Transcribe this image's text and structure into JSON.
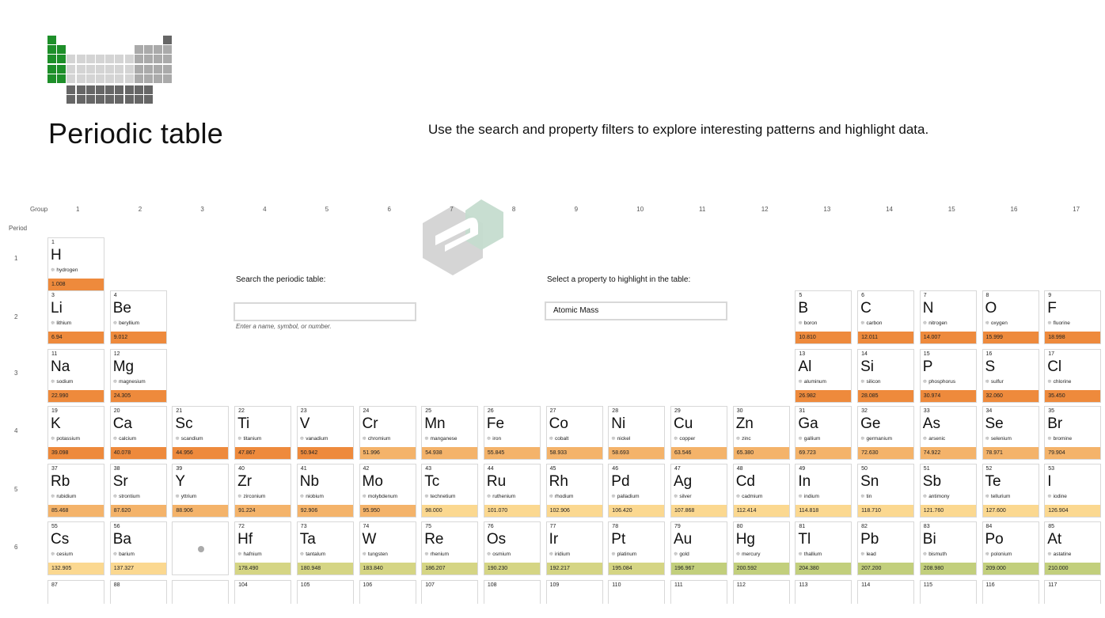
{
  "header": {
    "title": "Periodic table",
    "subtitle": "Use the search and property filters to explore interesting patterns and highlight data."
  },
  "axis": {
    "group_label": "Group",
    "period_label": "Period",
    "groups": [
      "1",
      "2",
      "3",
      "4",
      "5",
      "6",
      "7",
      "8",
      "9",
      "10",
      "11",
      "12",
      "13",
      "14",
      "15",
      "16",
      "17"
    ],
    "periods": [
      "1",
      "2",
      "3",
      "4",
      "5",
      "6"
    ]
  },
  "search": {
    "label": "Search the periodic table:",
    "value": "",
    "placeholder": "",
    "hint": "Enter a name, symbol, or number."
  },
  "property": {
    "label": "Select a property to highlight in the table:",
    "selected": "Atomic Mass"
  },
  "colors": {
    "mass_low": "#ee8a3c",
    "mass_mid": "#f4b36a",
    "mass_light": "#fbd890",
    "mass_olive": "#d5d584",
    "mass_green": "#c2cf7c",
    "logo_green": "#1e8f2a",
    "logo_light": "#d4d4d4",
    "logo_mid": "#aaaaaa",
    "logo_dark": "#666666"
  },
  "elements": [
    {
      "n": "1",
      "s": "H",
      "name": "hydrogen",
      "mass": "1.008",
      "g": 1,
      "p": 1,
      "c": "mass_low"
    },
    {
      "n": "3",
      "s": "Li",
      "name": "lithium",
      "mass": "6.94",
      "g": 1,
      "p": 2,
      "c": "mass_low"
    },
    {
      "n": "4",
      "s": "Be",
      "name": "beryllium",
      "mass": "9.012",
      "g": 2,
      "p": 2,
      "c": "mass_low"
    },
    {
      "n": "5",
      "s": "B",
      "name": "boron",
      "mass": "10.810",
      "g": 13,
      "p": 2,
      "c": "mass_low"
    },
    {
      "n": "6",
      "s": "C",
      "name": "carbon",
      "mass": "12.011",
      "g": 14,
      "p": 2,
      "c": "mass_low"
    },
    {
      "n": "7",
      "s": "N",
      "name": "nitrogen",
      "mass": "14.007",
      "g": 15,
      "p": 2,
      "c": "mass_low"
    },
    {
      "n": "8",
      "s": "O",
      "name": "oxygen",
      "mass": "15.999",
      "g": 16,
      "p": 2,
      "c": "mass_low"
    },
    {
      "n": "9",
      "s": "F",
      "name": "fluorine",
      "mass": "18.998",
      "g": 17,
      "p": 2,
      "c": "mass_low"
    },
    {
      "n": "11",
      "s": "Na",
      "name": "sodium",
      "mass": "22.990",
      "g": 1,
      "p": 3,
      "c": "mass_low"
    },
    {
      "n": "12",
      "s": "Mg",
      "name": "magnesium",
      "mass": "24.305",
      "g": 2,
      "p": 3,
      "c": "mass_low"
    },
    {
      "n": "13",
      "s": "Al",
      "name": "aluminum",
      "mass": "26.982",
      "g": 13,
      "p": 3,
      "c": "mass_low"
    },
    {
      "n": "14",
      "s": "Si",
      "name": "silicon",
      "mass": "28.085",
      "g": 14,
      "p": 3,
      "c": "mass_low"
    },
    {
      "n": "15",
      "s": "P",
      "name": "phosphorus",
      "mass": "30.974",
      "g": 15,
      "p": 3,
      "c": "mass_low"
    },
    {
      "n": "16",
      "s": "S",
      "name": "sulfur",
      "mass": "32.060",
      "g": 16,
      "p": 3,
      "c": "mass_low"
    },
    {
      "n": "17",
      "s": "Cl",
      "name": "chlorine",
      "mass": "35.450",
      "g": 17,
      "p": 3,
      "c": "mass_low"
    },
    {
      "n": "19",
      "s": "K",
      "name": "potassium",
      "mass": "39.098",
      "g": 1,
      "p": 4,
      "c": "mass_low"
    },
    {
      "n": "20",
      "s": "Ca",
      "name": "calcium",
      "mass": "40.078",
      "g": 2,
      "p": 4,
      "c": "mass_low"
    },
    {
      "n": "21",
      "s": "Sc",
      "name": "scandium",
      "mass": "44.956",
      "g": 3,
      "p": 4,
      "c": "mass_low"
    },
    {
      "n": "22",
      "s": "Ti",
      "name": "titanium",
      "mass": "47.867",
      "g": 4,
      "p": 4,
      "c": "mass_low"
    },
    {
      "n": "23",
      "s": "V",
      "name": "vanadium",
      "mass": "50.942",
      "g": 5,
      "p": 4,
      "c": "mass_low"
    },
    {
      "n": "24",
      "s": "Cr",
      "name": "chromium",
      "mass": "51.996",
      "g": 6,
      "p": 4,
      "c": "mass_mid"
    },
    {
      "n": "25",
      "s": "Mn",
      "name": "manganese",
      "mass": "54.938",
      "g": 7,
      "p": 4,
      "c": "mass_mid"
    },
    {
      "n": "26",
      "s": "Fe",
      "name": "iron",
      "mass": "55.845",
      "g": 8,
      "p": 4,
      "c": "mass_mid"
    },
    {
      "n": "27",
      "s": "Co",
      "name": "cobalt",
      "mass": "58.933",
      "g": 9,
      "p": 4,
      "c": "mass_mid"
    },
    {
      "n": "28",
      "s": "Ni",
      "name": "nickel",
      "mass": "58.693",
      "g": 10,
      "p": 4,
      "c": "mass_mid"
    },
    {
      "n": "29",
      "s": "Cu",
      "name": "copper",
      "mass": "63.546",
      "g": 11,
      "p": 4,
      "c": "mass_mid"
    },
    {
      "n": "30",
      "s": "Zn",
      "name": "zinc",
      "mass": "65.380",
      "g": 12,
      "p": 4,
      "c": "mass_mid"
    },
    {
      "n": "31",
      "s": "Ga",
      "name": "gallium",
      "mass": "69.723",
      "g": 13,
      "p": 4,
      "c": "mass_mid"
    },
    {
      "n": "32",
      "s": "Ge",
      "name": "germanium",
      "mass": "72.630",
      "g": 14,
      "p": 4,
      "c": "mass_mid"
    },
    {
      "n": "33",
      "s": "As",
      "name": "arsenic",
      "mass": "74.922",
      "g": 15,
      "p": 4,
      "c": "mass_mid"
    },
    {
      "n": "34",
      "s": "Se",
      "name": "selenium",
      "mass": "78.971",
      "g": 16,
      "p": 4,
      "c": "mass_mid"
    },
    {
      "n": "35",
      "s": "Br",
      "name": "bromine",
      "mass": "79.904",
      "g": 17,
      "p": 4,
      "c": "mass_mid"
    },
    {
      "n": "37",
      "s": "Rb",
      "name": "rubidium",
      "mass": "85.468",
      "g": 1,
      "p": 5,
      "c": "mass_mid"
    },
    {
      "n": "38",
      "s": "Sr",
      "name": "strontium",
      "mass": "87.620",
      "g": 2,
      "p": 5,
      "c": "mass_mid"
    },
    {
      "n": "39",
      "s": "Y",
      "name": "yttrium",
      "mass": "88.906",
      "g": 3,
      "p": 5,
      "c": "mass_mid"
    },
    {
      "n": "40",
      "s": "Zr",
      "name": "zirconium",
      "mass": "91.224",
      "g": 4,
      "p": 5,
      "c": "mass_mid"
    },
    {
      "n": "41",
      "s": "Nb",
      "name": "niobium",
      "mass": "92.906",
      "g": 5,
      "p": 5,
      "c": "mass_mid"
    },
    {
      "n": "42",
      "s": "Mo",
      "name": "molybdenum",
      "mass": "95.950",
      "g": 6,
      "p": 5,
      "c": "mass_mid"
    },
    {
      "n": "43",
      "s": "Tc",
      "name": "technetium",
      "mass": "98.000",
      "g": 7,
      "p": 5,
      "c": "mass_light"
    },
    {
      "n": "44",
      "s": "Ru",
      "name": "ruthenium",
      "mass": "101.070",
      "g": 8,
      "p": 5,
      "c": "mass_light"
    },
    {
      "n": "45",
      "s": "Rh",
      "name": "rhodium",
      "mass": "102.906",
      "g": 9,
      "p": 5,
      "c": "mass_light"
    },
    {
      "n": "46",
      "s": "Pd",
      "name": "palladium",
      "mass": "106.420",
      "g": 10,
      "p": 5,
      "c": "mass_light"
    },
    {
      "n": "47",
      "s": "Ag",
      "name": "silver",
      "mass": "107.868",
      "g": 11,
      "p": 5,
      "c": "mass_light"
    },
    {
      "n": "48",
      "s": "Cd",
      "name": "cadmium",
      "mass": "112.414",
      "g": 12,
      "p": 5,
      "c": "mass_light"
    },
    {
      "n": "49",
      "s": "In",
      "name": "indium",
      "mass": "114.818",
      "g": 13,
      "p": 5,
      "c": "mass_light"
    },
    {
      "n": "50",
      "s": "Sn",
      "name": "tin",
      "mass": "118.710",
      "g": 14,
      "p": 5,
      "c": "mass_light"
    },
    {
      "n": "51",
      "s": "Sb",
      "name": "antimony",
      "mass": "121.760",
      "g": 15,
      "p": 5,
      "c": "mass_light"
    },
    {
      "n": "52",
      "s": "Te",
      "name": "tellurium",
      "mass": "127.600",
      "g": 16,
      "p": 5,
      "c": "mass_light"
    },
    {
      "n": "53",
      "s": "I",
      "name": "iodine",
      "mass": "126.904",
      "g": 17,
      "p": 5,
      "c": "mass_light"
    },
    {
      "n": "55",
      "s": "Cs",
      "name": "cesium",
      "mass": "132.905",
      "g": 1,
      "p": 6,
      "c": "mass_light"
    },
    {
      "n": "56",
      "s": "Ba",
      "name": "barium",
      "mass": "137.327",
      "g": 2,
      "p": 6,
      "c": "mass_light"
    },
    {
      "n": "72",
      "s": "Hf",
      "name": "hafnium",
      "mass": "178.490",
      "g": 4,
      "p": 6,
      "c": "mass_olive"
    },
    {
      "n": "73",
      "s": "Ta",
      "name": "tantalum",
      "mass": "180.948",
      "g": 5,
      "p": 6,
      "c": "mass_olive"
    },
    {
      "n": "74",
      "s": "W",
      "name": "tungsten",
      "mass": "183.840",
      "g": 6,
      "p": 6,
      "c": "mass_olive"
    },
    {
      "n": "75",
      "s": "Re",
      "name": "rhenium",
      "mass": "186.207",
      "g": 7,
      "p": 6,
      "c": "mass_olive"
    },
    {
      "n": "76",
      "s": "Os",
      "name": "osmium",
      "mass": "190.230",
      "g": 8,
      "p": 6,
      "c": "mass_olive"
    },
    {
      "n": "77",
      "s": "Ir",
      "name": "iridium",
      "mass": "192.217",
      "g": 9,
      "p": 6,
      "c": "mass_olive"
    },
    {
      "n": "78",
      "s": "Pt",
      "name": "platinum",
      "mass": "195.084",
      "g": 10,
      "p": 6,
      "c": "mass_olive"
    },
    {
      "n": "79",
      "s": "Au",
      "name": "gold",
      "mass": "196.967",
      "g": 11,
      "p": 6,
      "c": "mass_green"
    },
    {
      "n": "80",
      "s": "Hg",
      "name": "mercury",
      "mass": "200.592",
      "g": 12,
      "p": 6,
      "c": "mass_green"
    },
    {
      "n": "81",
      "s": "Tl",
      "name": "thallium",
      "mass": "204.380",
      "g": 13,
      "p": 6,
      "c": "mass_green"
    },
    {
      "n": "82",
      "s": "Pb",
      "name": "lead",
      "mass": "207.200",
      "g": 14,
      "p": 6,
      "c": "mass_green"
    },
    {
      "n": "83",
      "s": "Bi",
      "name": "bismuth",
      "mass": "208.980",
      "g": 15,
      "p": 6,
      "c": "mass_green"
    },
    {
      "n": "84",
      "s": "Po",
      "name": "polonium",
      "mass": "209.000",
      "g": 16,
      "p": 6,
      "c": "mass_green"
    },
    {
      "n": "85",
      "s": "At",
      "name": "astatine",
      "mass": "210.000",
      "g": 17,
      "p": 6,
      "c": "mass_green"
    }
  ],
  "period7_numbers": [
    {
      "n": "87",
      "g": 1
    },
    {
      "n": "88",
      "g": 2
    },
    {
      "n": "",
      "g": 3
    },
    {
      "n": "104",
      "g": 4
    },
    {
      "n": "105",
      "g": 5
    },
    {
      "n": "106",
      "g": 6
    },
    {
      "n": "107",
      "g": 7
    },
    {
      "n": "108",
      "g": 8
    },
    {
      "n": "109",
      "g": 9
    },
    {
      "n": "110",
      "g": 10
    },
    {
      "n": "111",
      "g": 11
    },
    {
      "n": "112",
      "g": 12
    },
    {
      "n": "113",
      "g": 13
    },
    {
      "n": "114",
      "g": 14
    },
    {
      "n": "115",
      "g": 15
    },
    {
      "n": "116",
      "g": 16
    },
    {
      "n": "117",
      "g": 17
    }
  ],
  "icons": {
    "element_state": "atom-icon",
    "lanthanide_placeholder": "dot-icon",
    "watermark": "brand-watermark-icon",
    "logo": "periodic-table-logo-icon"
  }
}
